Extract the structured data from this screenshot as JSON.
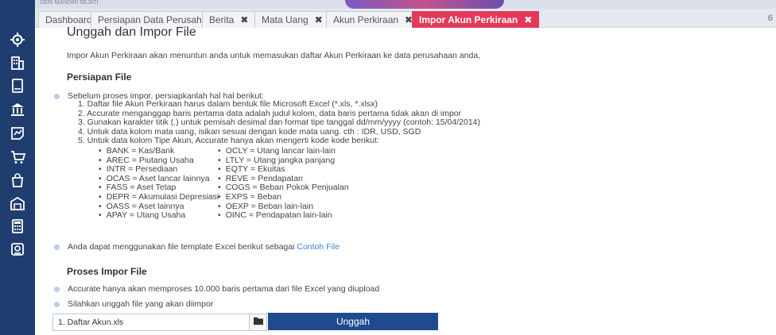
{
  "header": {
    "strip_text": "DERI MANDIRI SEJATI"
  },
  "tabs": [
    {
      "label": "Dashboard",
      "closable": false,
      "active": false
    },
    {
      "label": "Persiapan Data Perusahaan",
      "closable": false,
      "active": false
    },
    {
      "label": "Berita",
      "closable": true,
      "active": false
    },
    {
      "label": "Mata Uang",
      "closable": true,
      "active": false
    },
    {
      "label": "Akun Perkiraan",
      "closable": true,
      "active": false
    },
    {
      "label": "Impor Akun Perkiraan",
      "closable": true,
      "active": true
    }
  ],
  "tab_close_symbol": "✖",
  "tab_overflow": "6",
  "sidebar": {
    "icons": [
      "gear-icon",
      "building-icon",
      "book-icon",
      "bank-icon",
      "chart-icon",
      "cart-icon",
      "shopping-bag-icon",
      "warehouse-icon",
      "calculator-icon",
      "report-icon"
    ]
  },
  "page": {
    "title": "Unggah dan Impor File",
    "intro": "Impor Akun Perkiraan akan menuntun anda untuk memasukan daftar Akun Perkiraan ke data perusahaan anda,"
  },
  "persiapan": {
    "title": "Persiapan File",
    "lead": "Sebelum proses impor, persiapkanlah hal hal berikut:",
    "steps": [
      "1. Daftar file Akun Perkiraan harus dalam bentuk file Microsoft Excel (*.xls, *.xlsx)",
      "2. Accurate menganggap baris pertama data adalah judul kolom, data baris pertama tidak akan di impor",
      "3. Gunakan karakter titik (.) untuk pemisah desimal dan format tipe tanggal dd/mm/yyyy (contoh: 15/04/2014)",
      "4. Untuk data kolom mata uang, isikan sesuai dengan kode mata uang. cth : IDR, USD, SGD",
      "5. Untuk data kolom Tipe Akun, Accurate hanya akan mengerti kode kode berikut:"
    ],
    "codes_left": [
      "BANK = Kas/Bank",
      "AREC = Piutang Usaha",
      "INTR = Persediaan",
      "OCAS = Aset lancar lainnya",
      "FASS = Aset Tetap",
      "DEPR = Akumulasi Depresiasi",
      "OASS = Aset lainnya",
      "APAY = Utang Usaha"
    ],
    "codes_right": [
      "OCLY = Utang lancar lain-lain",
      "LTLY = Utang jangka panjang",
      "EQTY = Ekuitas",
      "REVE = Pendapatan",
      "COGS = Beban Pokok Penjualan",
      "EXPS = Beban",
      "OEXP = Beban lain-lain",
      "OINC = Pendapatan lain-lain"
    ],
    "template_text": "Anda dapat menggunakan file template Excel berikut sebagai",
    "template_link": "Contoh File"
  },
  "proses": {
    "title": "Proses Impor File",
    "note1": "Accurate hanya akan memproses 10.000 baris pertama dari file Excel yang diupload",
    "note2": "Silahkan unggah file yang akan diimpor",
    "file_value": "1. Daftar Akun.xls",
    "upload_label": "Unggah"
  }
}
